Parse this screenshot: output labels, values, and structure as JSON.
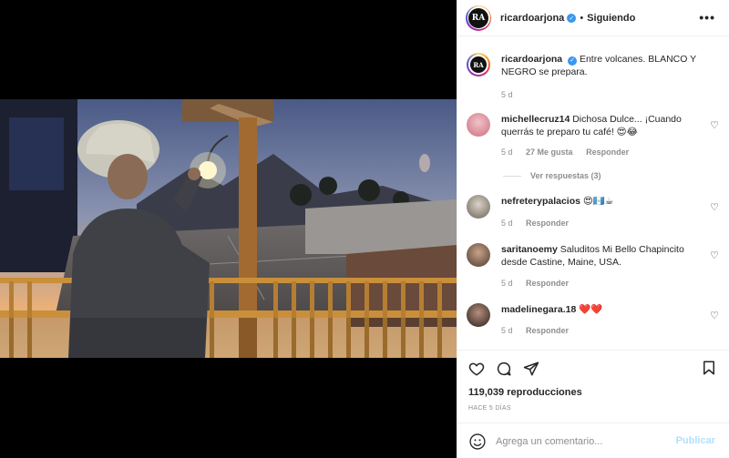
{
  "post": {
    "author": "ricardoarjona",
    "follow_status": "Siguiendo",
    "more_label": "•••",
    "caption_username": "ricardoarjona",
    "caption": "Entre volcanes. BLANCO Y NEGRO se prepara.",
    "caption_age": "5 d",
    "logo_text": "RA"
  },
  "comments": [
    {
      "username": "michellecruz14",
      "text": "Dichosa Dulce... ¡Cuando querrás te preparo tu café! 😍😂",
      "age": "5 d",
      "likes": "27 Me gusta",
      "reply": "Responder",
      "view_replies": "Ver respuestas (3)"
    },
    {
      "username": "nefreterypalacios",
      "text": "😍🇬🇹☕",
      "age": "5 d",
      "reply": "Responder"
    },
    {
      "username": "saritanoemy",
      "text": "Saluditos Mi Bello Chapincito desde Castine, Maine, USA.",
      "age": "5 d",
      "reply": "Responder"
    },
    {
      "username": "madelinegara.18",
      "text": "❤️❤️",
      "age": "5 d",
      "reply": "Responder"
    }
  ],
  "stats": {
    "views": "119,039 reproducciones",
    "time_ago": "HACE 5 DÍAS"
  },
  "composer": {
    "placeholder": "Agrega un comentario...",
    "publish": "Publicar"
  },
  "icons": [
    "heart-icon",
    "comment-icon",
    "share-icon",
    "bookmark-icon",
    "emoji-icon",
    "verified-badge-icon",
    "more-options-icon"
  ],
  "colors": {
    "verified": "#3897f0",
    "publish_disabled": "#b2dffc",
    "muted": "#8e8e8e"
  }
}
